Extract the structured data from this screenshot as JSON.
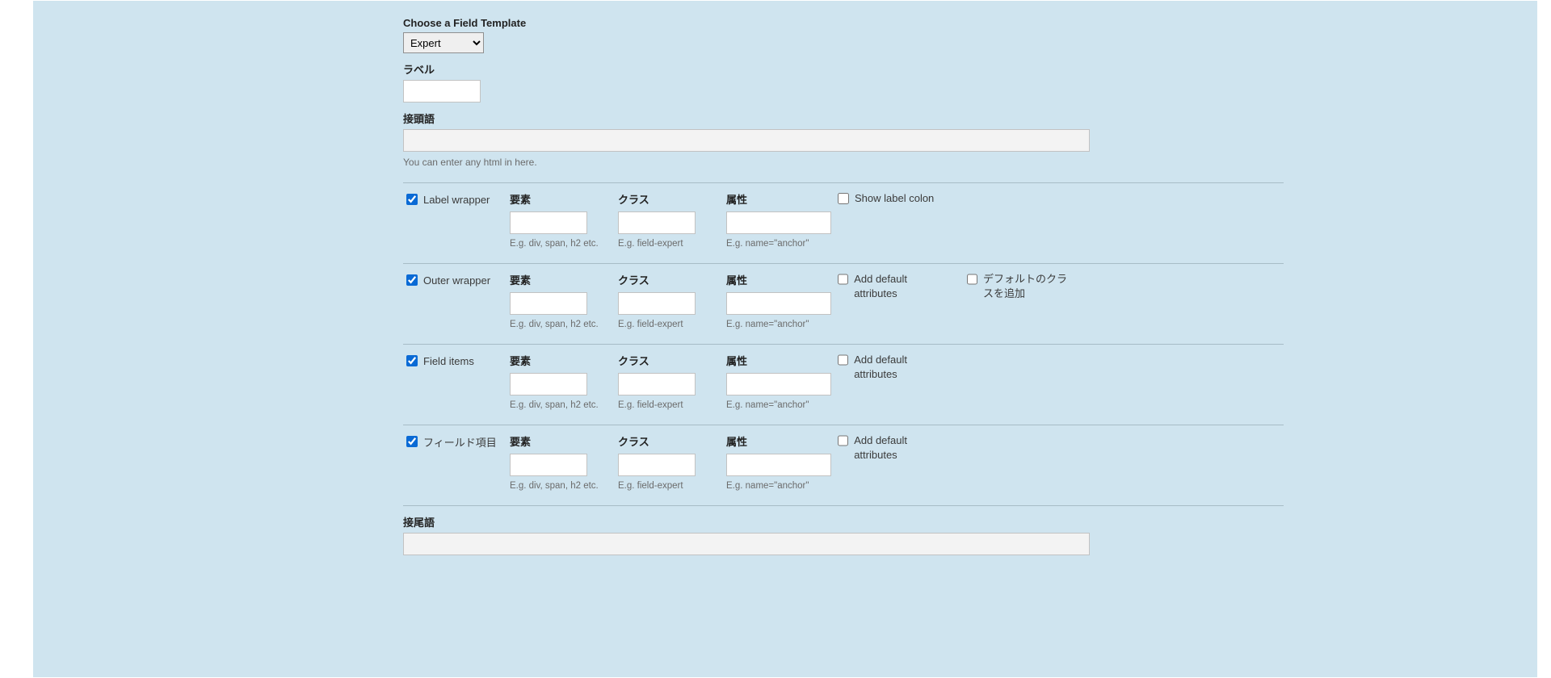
{
  "template": {
    "label": "Choose a Field Template",
    "selected": "Expert"
  },
  "labelField": {
    "label": "ラベル",
    "value": ""
  },
  "prefix": {
    "label": "接頭語",
    "value": "",
    "help": "You can enter any html in here."
  },
  "suffix": {
    "label": "接尾語"
  },
  "cols": {
    "element": {
      "label": "要素",
      "help": "E.g. div, span, h2 etc."
    },
    "class": {
      "label": "クラス",
      "help": "E.g. field-expert"
    },
    "attr": {
      "label": "属性",
      "help": "E.g. name=\"anchor\""
    }
  },
  "flags": {
    "showLabelColon": "Show label colon",
    "addDefaultAttributes": "Add default attributes",
    "addDefaultClasses": "デフォルトのクラスを追加"
  },
  "rows": {
    "labelWrapper": {
      "label": "Label wrapper"
    },
    "outerWrapper": {
      "label": "Outer wrapper"
    },
    "fieldItems": {
      "label": "Field items"
    },
    "fieldItem": {
      "label": "フィールド項目"
    }
  }
}
